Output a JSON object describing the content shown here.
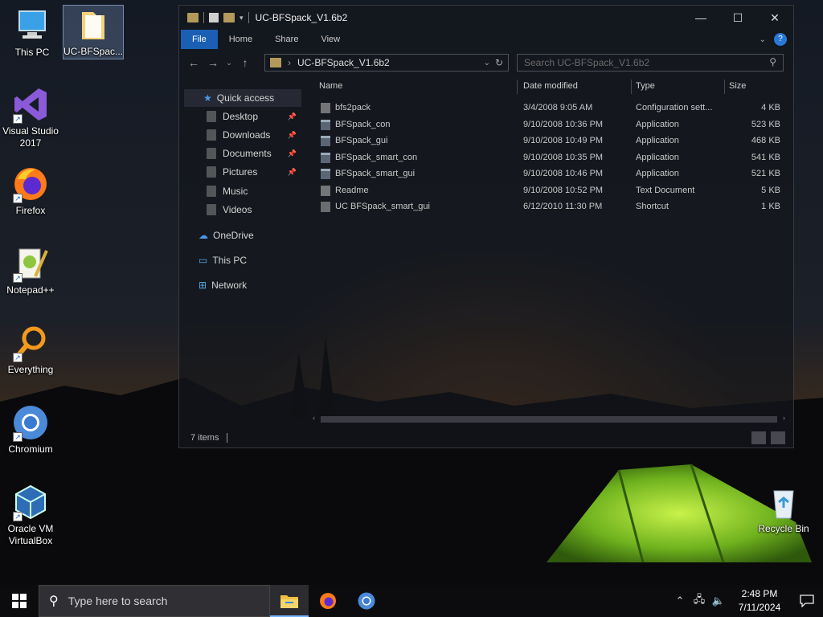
{
  "desktop": {
    "icons": [
      {
        "label": "This PC",
        "icon": "computer-icon"
      },
      {
        "label": "UC-BFSpac...",
        "icon": "folder-icon"
      },
      {
        "label": "Visual Studio 2017",
        "icon": "visual-studio-icon"
      },
      {
        "label": "Firefox",
        "icon": "firefox-icon"
      },
      {
        "label": "Notepad++",
        "icon": "notepadpp-icon"
      },
      {
        "label": "Everything",
        "icon": "everything-icon"
      },
      {
        "label": "Chromium",
        "icon": "chromium-icon"
      },
      {
        "label": "Oracle VM VirtualBox",
        "icon": "virtualbox-icon"
      },
      {
        "label": "Recycle Bin",
        "icon": "recycle-bin-icon"
      }
    ]
  },
  "explorer": {
    "title": "UC-BFSpack_V1.6b2",
    "ribbon_tabs": [
      "File",
      "Home",
      "Share",
      "View"
    ],
    "address": "UC-BFSpack_V1.6b2",
    "search_placeholder": "Search UC-BFSpack_V1.6b2",
    "nav": {
      "quick_access": "Quick access",
      "pinned": [
        "Desktop",
        "Downloads",
        "Documents",
        "Pictures"
      ],
      "folders": [
        "Music",
        "Videos"
      ],
      "onedrive": "OneDrive",
      "this_pc": "This PC",
      "network": "Network"
    },
    "columns": [
      "Name",
      "Date modified",
      "Type",
      "Size"
    ],
    "files": [
      {
        "name": "bfs2pack",
        "date": "3/4/2008 9:05 AM",
        "type": "Configuration sett...",
        "size": "4 KB",
        "kind": "doc"
      },
      {
        "name": "BFSpack_con",
        "date": "9/10/2008 10:36 PM",
        "type": "Application",
        "size": "523 KB",
        "kind": "app"
      },
      {
        "name": "BFSpack_gui",
        "date": "9/10/2008 10:49 PM",
        "type": "Application",
        "size": "468 KB",
        "kind": "app"
      },
      {
        "name": "BFSpack_smart_con",
        "date": "9/10/2008 10:35 PM",
        "type": "Application",
        "size": "541 KB",
        "kind": "app"
      },
      {
        "name": "BFSpack_smart_gui",
        "date": "9/10/2008 10:46 PM",
        "type": "Application",
        "size": "521 KB",
        "kind": "app"
      },
      {
        "name": "Readme",
        "date": "9/10/2008 10:52 PM",
        "type": "Text Document",
        "size": "5 KB",
        "kind": "doc"
      },
      {
        "name": "UC BFSpack_smart_gui",
        "date": "6/12/2010 11:30 PM",
        "type": "Shortcut",
        "size": "1 KB",
        "kind": "lnk"
      }
    ],
    "status": "7 items"
  },
  "taskbar": {
    "search_placeholder": "Type here to search",
    "apps": [
      "file-explorer-icon",
      "firefox-icon",
      "chromium-icon"
    ],
    "time": "2:48 PM",
    "date": "7/11/2024"
  }
}
